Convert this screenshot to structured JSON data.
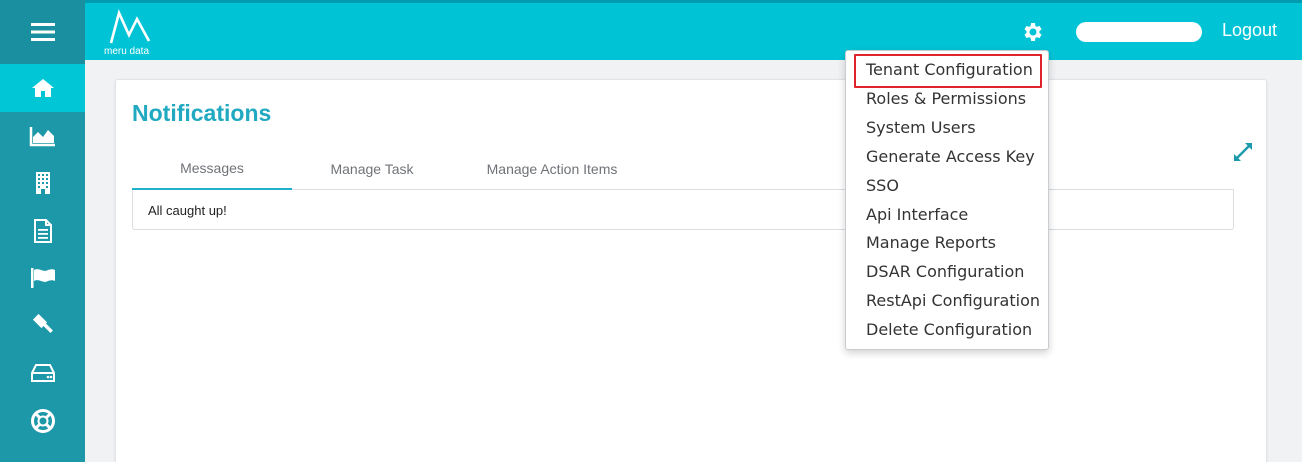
{
  "header": {
    "logo_text": "meru data",
    "logout_label": "Logout",
    "user_name": ""
  },
  "sidebar": {
    "items": [
      {
        "icon": "menu-icon"
      },
      {
        "icon": "home-icon"
      },
      {
        "icon": "area-chart-icon"
      },
      {
        "icon": "building-icon"
      },
      {
        "icon": "document-icon"
      },
      {
        "icon": "flag-icon"
      },
      {
        "icon": "gavel-icon"
      },
      {
        "icon": "hard-drive-icon"
      },
      {
        "icon": "life-ring-icon"
      }
    ]
  },
  "card": {
    "title": "Notifications",
    "tabs": [
      {
        "label": "Messages",
        "active": true
      },
      {
        "label": "Manage Task",
        "active": false
      },
      {
        "label": "Manage Action Items",
        "active": false
      }
    ],
    "empty_message": "All caught up!"
  },
  "settings_menu": {
    "items": [
      {
        "label": "Tenant Configuration",
        "highlighted": true
      },
      {
        "label": "Roles & Permissions"
      },
      {
        "label": "System Users"
      },
      {
        "label": "Generate Access Key"
      },
      {
        "label": "SSO"
      },
      {
        "label": "Api Interface"
      },
      {
        "label": "Manage Reports"
      },
      {
        "label": "DSAR Configuration"
      },
      {
        "label": "RestApi Configuration"
      },
      {
        "label": "Delete Configuration"
      }
    ]
  },
  "colors": {
    "topbar": "#00c4d6",
    "sidebar": "#1c98a8",
    "accent": "#21a9c1",
    "highlight_border": "#e0222b"
  }
}
